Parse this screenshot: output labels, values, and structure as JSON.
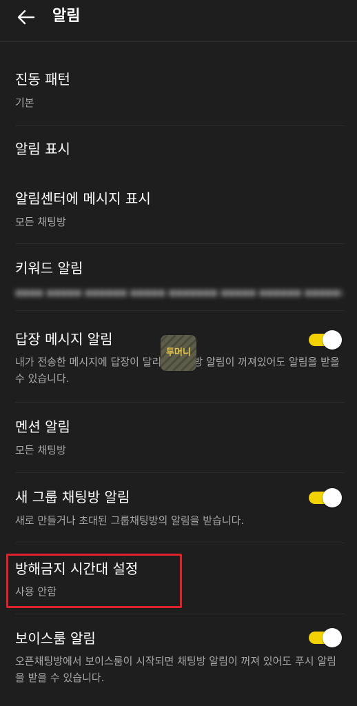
{
  "header": {
    "title": "알림"
  },
  "rows": [
    {
      "title": "진동 패턴",
      "subtitle": "기본"
    },
    {
      "title": "알림 표시"
    },
    {
      "title": "알림센터에 메시지 표시",
      "subtitle": "모든 채팅방"
    },
    {
      "title": "키워드 알림",
      "subtitle_blurred": "▪▪▪▪ ▪▪▪▪▪ ▪▪▪▪▪▪ ▪▪▪▪▪ ▪▪▪▪▪▪▪ ▪▪▪▪▪ ▪▪▪▪▪▪ ▪▪▪▪▪▪▪"
    },
    {
      "title": "답장 메시지 알림",
      "subtitle": "내가 전송한 메시지에 답장이 달리면 채팅방 알림이 꺼져있어도 알림을 받을 수 있습니다.",
      "toggle_on": true
    },
    {
      "title": "멘션 알림",
      "subtitle": "모든 채팅방"
    },
    {
      "title": "새 그룹 채팅방 알림",
      "subtitle": "새로 만들거나 초대된 그룹채팅방의 알림을 받습니다.",
      "toggle_on": true
    },
    {
      "title": "방해금지 시간대 설정",
      "subtitle": "사용 안함"
    },
    {
      "title": "보이스룸 알림",
      "subtitle": "오픈채팅방에서 보이스룸이 시작되면 채팅방 알림이 꺼져 있어도 푸시 알림을 받을 수 있습니다.",
      "toggle_on": true
    }
  ],
  "watermark": {
    "text": "투머니"
  },
  "colors": {
    "background": "#1e1e1e",
    "toggle_track": "#f2d200",
    "toggle_knob": "#ffffff",
    "subtitle": "#a8a8a8",
    "highlight_border": "#e0232a"
  }
}
